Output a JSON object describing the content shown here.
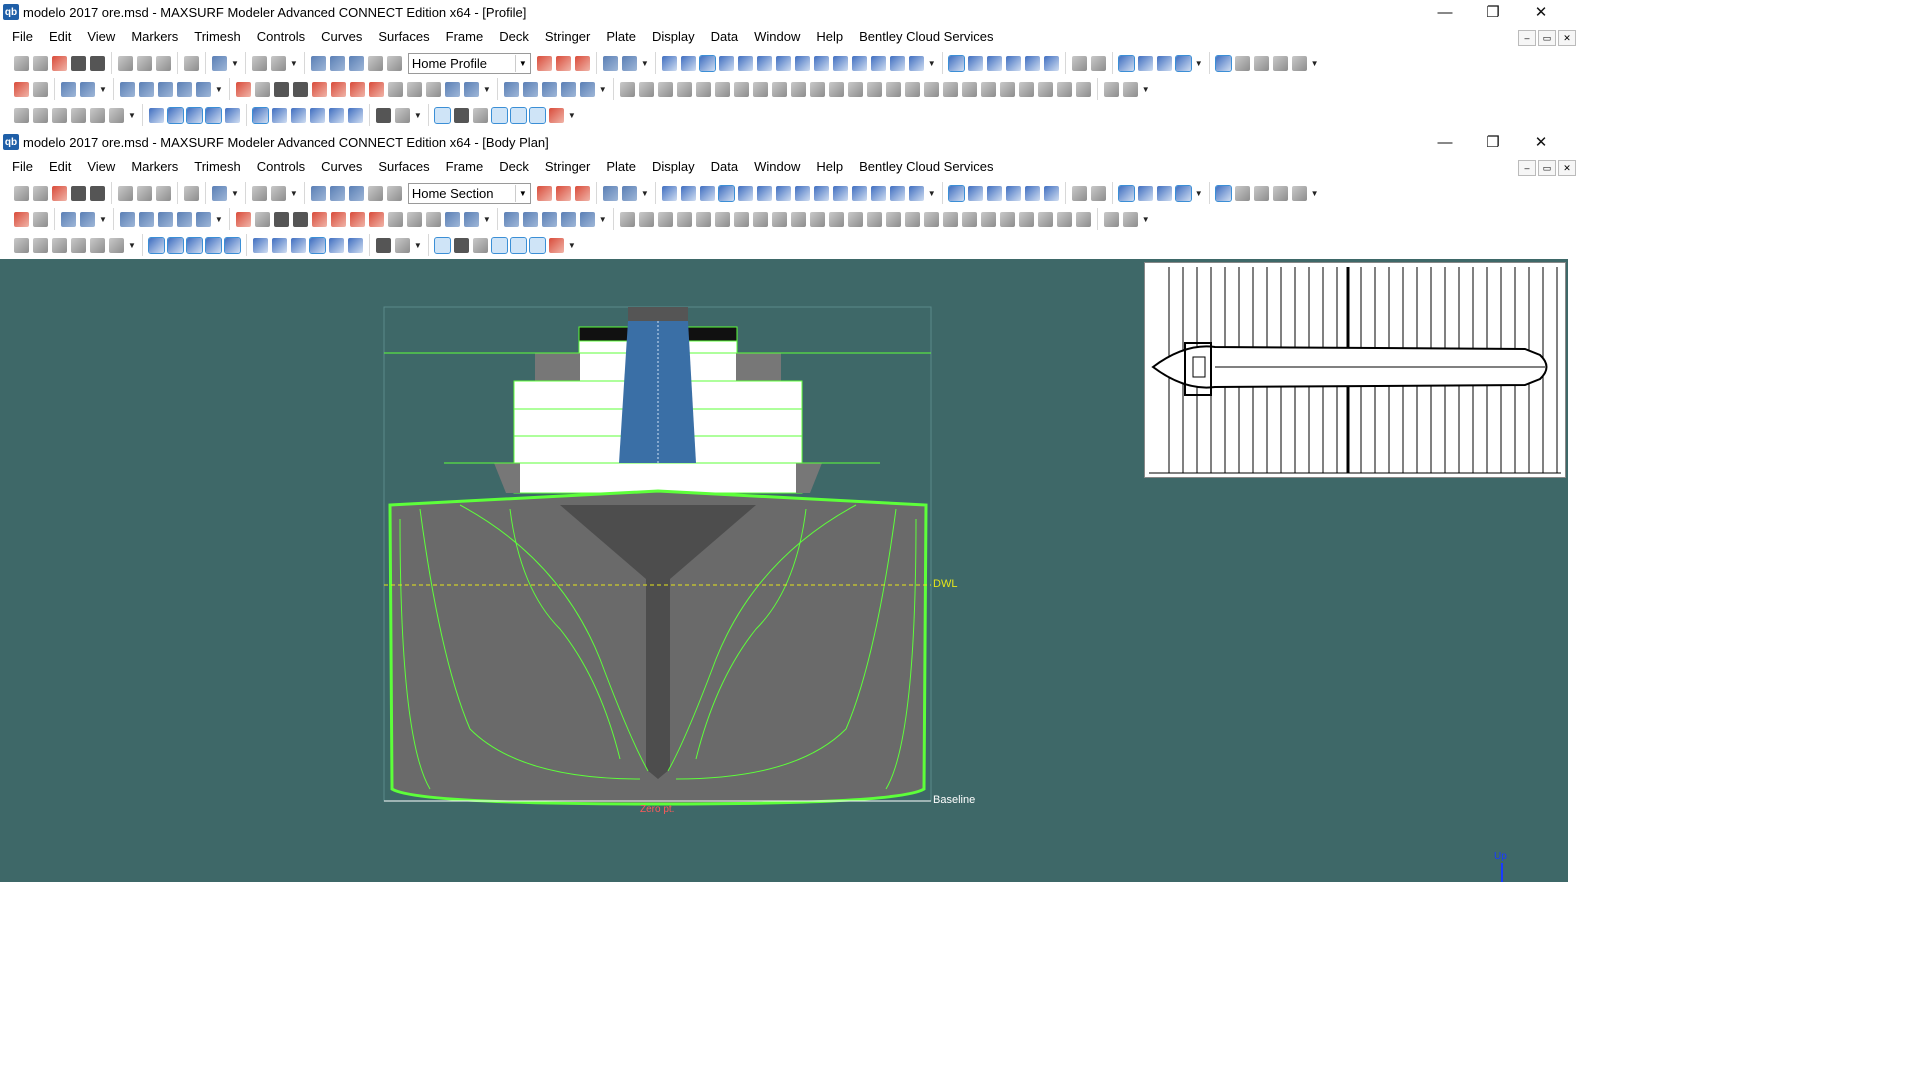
{
  "window1": {
    "title": "modelo 2017 ore.msd - MAXSURF Modeler Advanced CONNECT Edition x64 - [Profile]",
    "view_combo": "Home Profile"
  },
  "window2": {
    "title": "modelo 2017 ore.msd - MAXSURF Modeler Advanced CONNECT Edition x64 - [Body Plan]",
    "view_combo": "Home Section"
  },
  "app_icon": "qb",
  "menus": [
    "File",
    "Edit",
    "View",
    "Markers",
    "Trimesh",
    "Controls",
    "Curves",
    "Surfaces",
    "Frame",
    "Deck",
    "Stringer",
    "Plate",
    "Display",
    "Data",
    "Window",
    "Help",
    "Bentley Cloud Services"
  ],
  "window_controls": {
    "minimize": "—",
    "restore": "❐",
    "close": "✕"
  },
  "mdi_controls": [
    "–",
    "▭",
    "✕"
  ],
  "viewport": {
    "labels": {
      "dwl": "DWL",
      "baseline": "Baseline",
      "zero": "Zero pt.",
      "up": "Up"
    },
    "colors": {
      "background": "#3e6868",
      "hull_lines": "#5dff3a",
      "dwl": "#e6e61a",
      "zero": "#ff5a5a",
      "mesh": "#8a8a8a"
    }
  }
}
